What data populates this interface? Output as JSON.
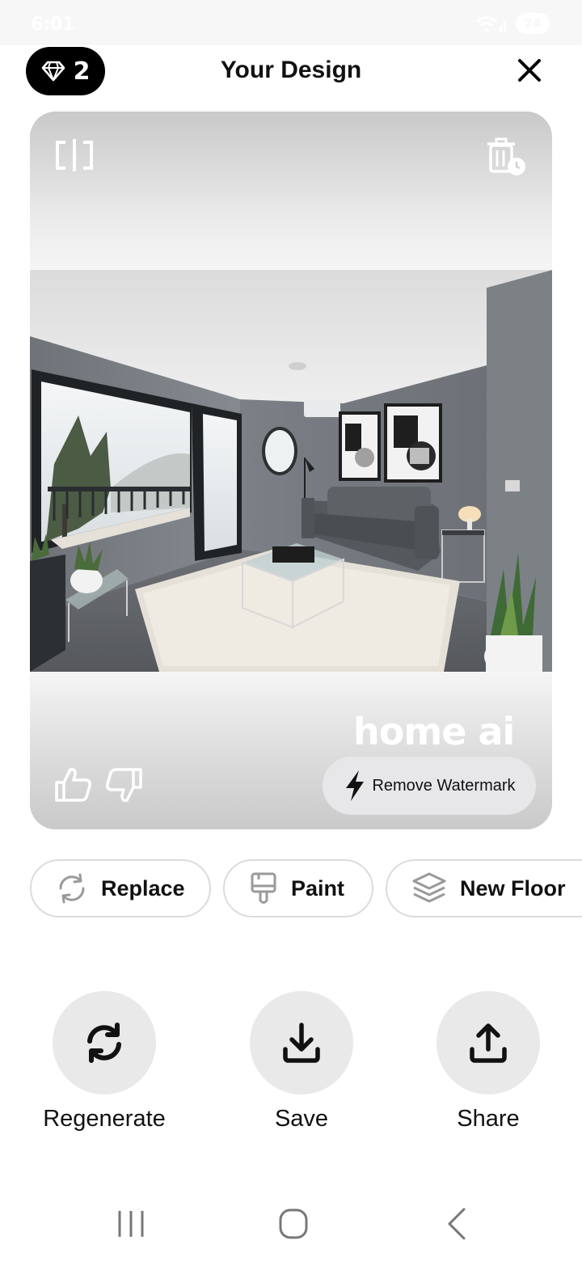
{
  "status_bar": {
    "time": "6:01",
    "battery": "74"
  },
  "header": {
    "gem_count": "2",
    "title": "Your Design"
  },
  "card": {
    "watermark_text": "home ai",
    "remove_watermark_label": "Remove Watermark"
  },
  "chips": [
    {
      "label": "Replace",
      "icon": "refresh-arrows-icon"
    },
    {
      "label": "Paint",
      "icon": "paint-brush-icon"
    },
    {
      "label": "New Floor",
      "icon": "layers-icon"
    }
  ],
  "actions": [
    {
      "label": "Regenerate",
      "icon": "regenerate-icon"
    },
    {
      "label": "Save",
      "icon": "download-icon"
    },
    {
      "label": "Share",
      "icon": "share-icon"
    }
  ],
  "colors": {
    "accent": "#000000",
    "chip_border": "#dcdcdc",
    "action_bg": "#e9e9e9",
    "remove_wm_bg": "#e7e7ea"
  }
}
